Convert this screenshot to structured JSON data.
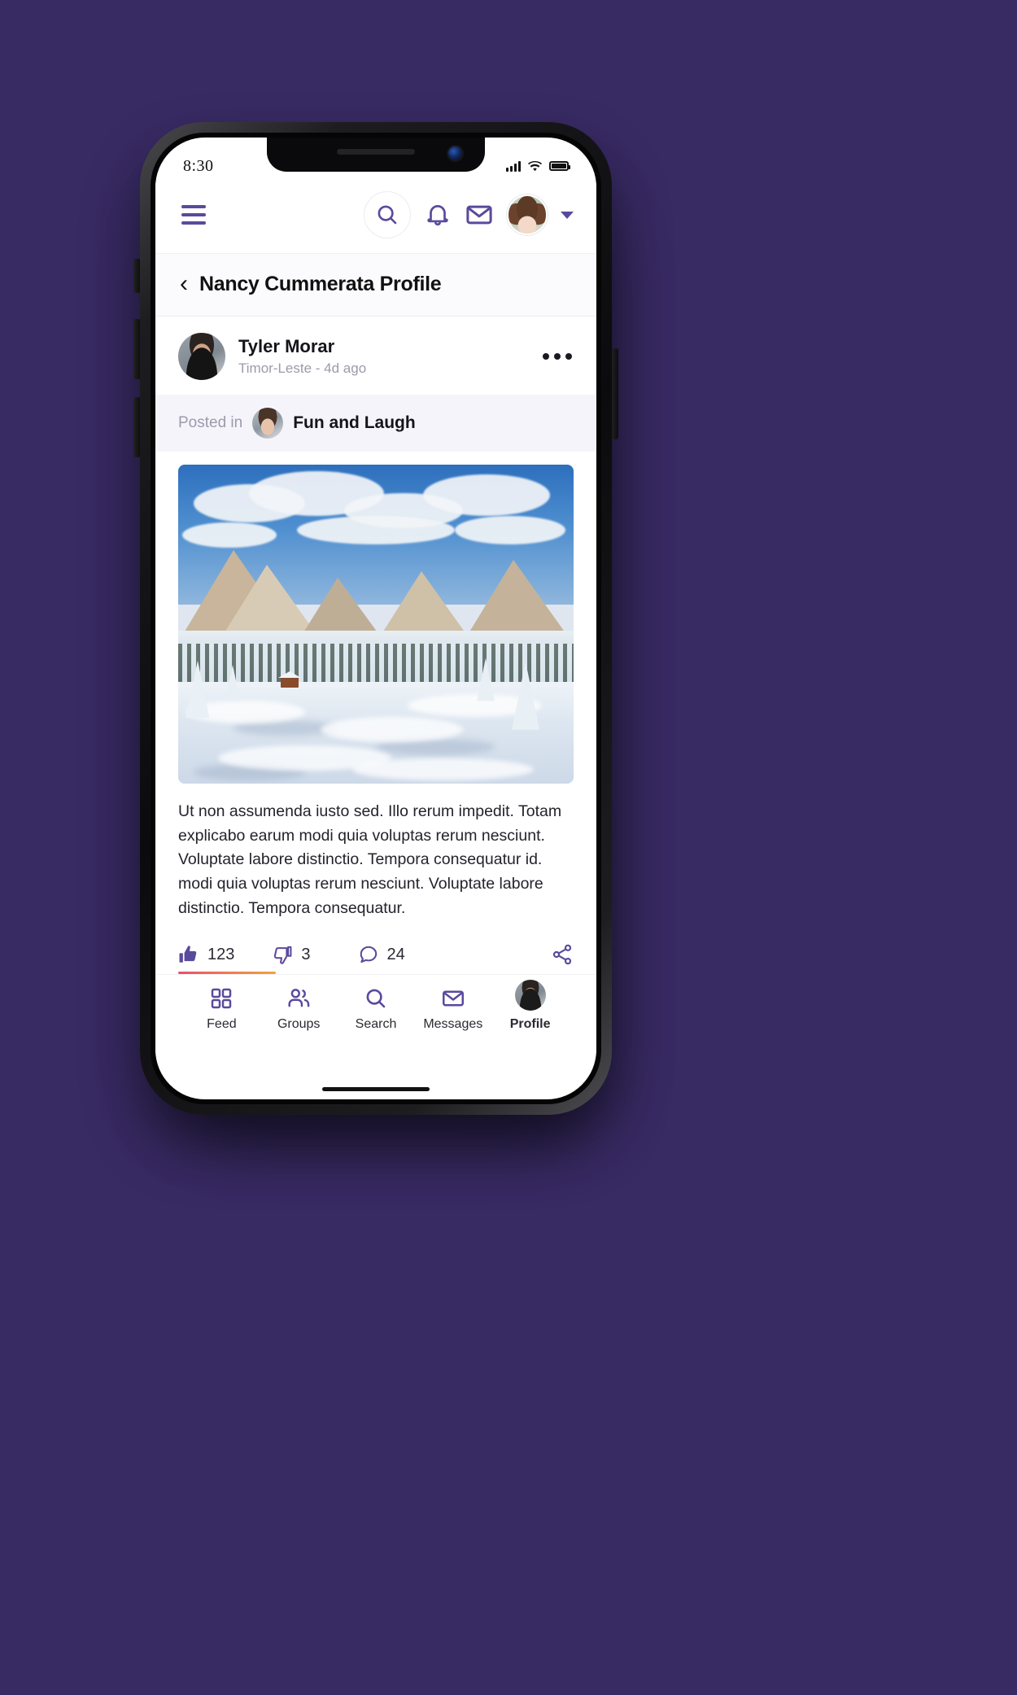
{
  "theme": {
    "background": "#382a63",
    "accent": "#5a4a9c",
    "surface": "#ffffff",
    "muted_surface": "#f6f4fb",
    "text": "#14141a",
    "muted_text": "#9b9bab",
    "like_bar_from": "#e8516a",
    "like_bar_to": "#f0a33c"
  },
  "status_bar": {
    "time": "8:30",
    "signal_icon": "signal-bars-icon",
    "wifi_icon": "wifi-icon",
    "battery_icon": "battery-icon"
  },
  "app_nav": {
    "menu_icon": "hamburger-menu-icon",
    "search_icon": "search-icon",
    "notifications_icon": "bell-icon",
    "messages_icon": "envelope-icon",
    "avatar_icon": "user-avatar",
    "dropdown_icon": "chevron-down-icon"
  },
  "page_header": {
    "back_icon": "chevron-left-icon",
    "title": "Nancy Cummerata Profile"
  },
  "post": {
    "author": "Tyler Morar",
    "meta": "Timor-Leste - 4d ago",
    "author_avatar_icon": "author-avatar",
    "more_icon": "more-options-icon",
    "posted_in_label": "Posted in",
    "group_name": "Fun and Laugh",
    "group_avatar_icon": "group-avatar",
    "image_icon": "snowy-mountain-photo",
    "body": "Ut non assumenda iusto sed. Illo rerum impedit. Totam explicabo earum modi quia voluptas rerum nesciunt. Voluptate labore distinctio. Tempora consequatur id. modi quia voluptas rerum nesciunt. Voluptate labore distinctio. Tempora consequatur.",
    "actions": {
      "like_icon": "thumbs-up-icon",
      "like_count": "123",
      "dislike_icon": "thumbs-down-icon",
      "dislike_count": "3",
      "comment_icon": "comment-bubble-icon",
      "comment_count": "24",
      "share_icon": "share-icon"
    }
  },
  "tab_bar": {
    "items": [
      {
        "label": "Feed",
        "icon": "grid-icon",
        "active": false
      },
      {
        "label": "Groups",
        "icon": "people-icon",
        "active": false
      },
      {
        "label": "Search",
        "icon": "search-icon",
        "active": false
      },
      {
        "label": "Messages",
        "icon": "envelope-icon",
        "active": false
      },
      {
        "label": "Profile",
        "icon": "profile-avatar-icon",
        "active": true
      }
    ]
  }
}
